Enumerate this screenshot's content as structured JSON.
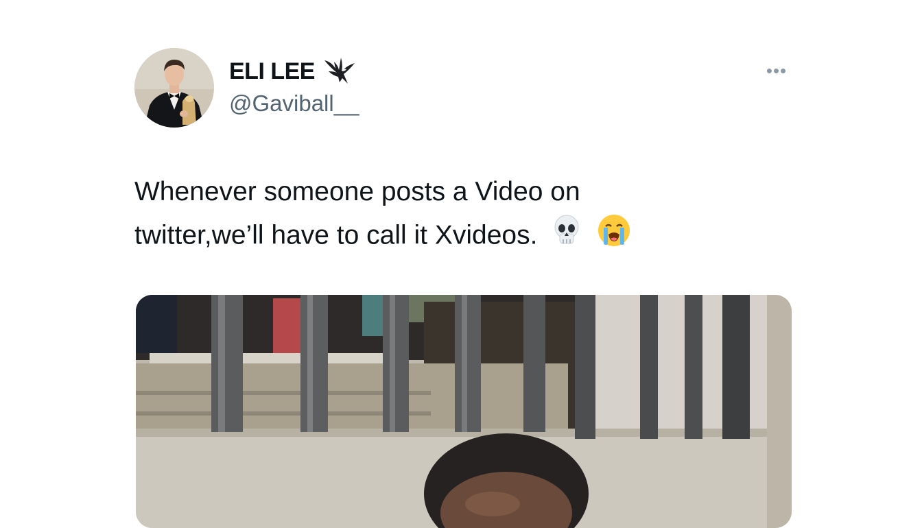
{
  "tweet": {
    "author": {
      "display_name": "ELI LEE",
      "badge_icon": "eagle-icon",
      "handle": "@Gaviball__"
    },
    "more_icon": "more-dots-icon",
    "text_line1": "Whenever someone posts a Video on",
    "text_line2": "twitter,we’ll have to call it Xvideos.",
    "emojis": [
      "skull-emoji",
      "loudly-crying-face-emoji"
    ],
    "media": {
      "kind": "photo"
    }
  }
}
